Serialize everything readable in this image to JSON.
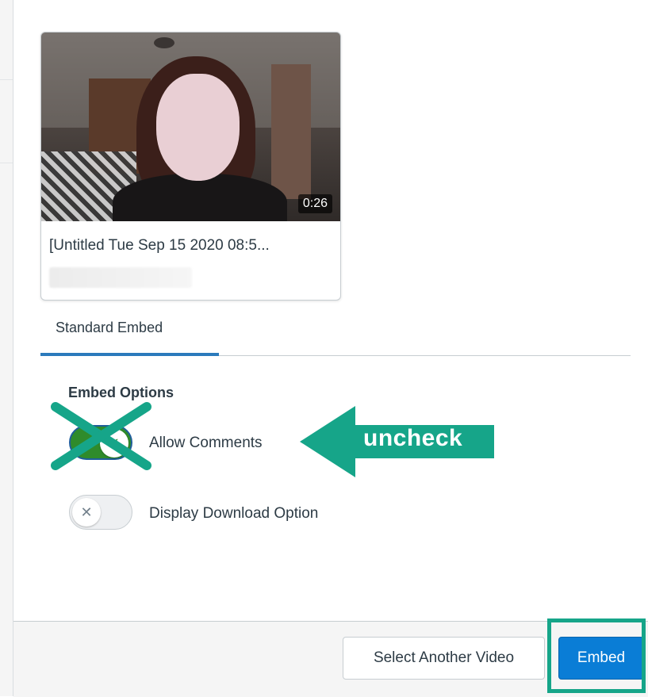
{
  "video": {
    "duration": "0:26",
    "title": "[Untitled Tue Sep 15 2020 08:5..."
  },
  "tabs": [
    {
      "label": "Standard Embed",
      "selected": true
    }
  ],
  "embed_options": {
    "heading": "Embed Options",
    "allow_comments": {
      "label": "Allow Comments",
      "checked": true
    },
    "display_download": {
      "label": "Display Download Option",
      "checked": false
    }
  },
  "annotation": {
    "arrow_text": "uncheck",
    "color": "#16a589"
  },
  "footer": {
    "select_another_label": "Select Another Video",
    "embed_label": "Embed"
  },
  "colors": {
    "primary": "#0a7dd6",
    "toggle_on": "#2f8b2b",
    "tab_accent": "#2b7abc"
  },
  "icons": {
    "toggle_on_knob": "check-icon",
    "toggle_off_knob": "x-icon"
  }
}
